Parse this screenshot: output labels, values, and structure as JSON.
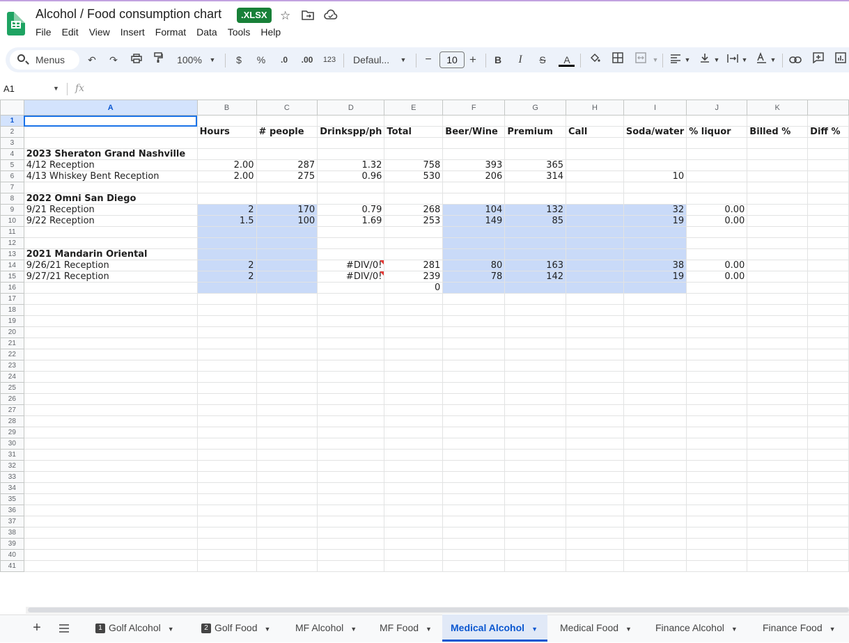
{
  "document": {
    "title": "Alcohol /  Food consumption chart",
    "badge": ".XLSX"
  },
  "menu": [
    "File",
    "Edit",
    "View",
    "Insert",
    "Format",
    "Data",
    "Tools",
    "Help"
  ],
  "toolbar": {
    "search_label": "Menus",
    "zoom": "100%",
    "currency": "$",
    "percent": "%",
    "decrease_decimals": ".0",
    "increase_decimals": ".00",
    "number_format": "123",
    "font": "Defaul...",
    "font_size": "10",
    "minus": "−",
    "plus": "+",
    "bold": "B",
    "italic": "I",
    "strike": "S",
    "text_color": "A"
  },
  "formula_bar": {
    "cell_ref": "A1",
    "fx": "fx"
  },
  "sheet": {
    "columns": [
      "A",
      "B",
      "C",
      "D",
      "E",
      "F",
      "G",
      "H",
      "I",
      "J",
      "K"
    ],
    "row_header_labels": [
      "1",
      "2",
      "3",
      "4",
      "5",
      "6",
      "7",
      "8",
      "9",
      "10",
      "11",
      "12",
      "13",
      "14",
      "15",
      "16",
      "17",
      "18",
      "19",
      "20",
      "21",
      "22",
      "23",
      "24",
      "25",
      "26",
      "27",
      "28",
      "29",
      "30",
      "31",
      "32",
      "33",
      "34",
      "35",
      "36",
      "37",
      "38",
      "39",
      "40",
      "41"
    ],
    "headers": [
      "",
      "Hours",
      "# people",
      "Drinkspp/ph",
      "Total",
      "Beer/Wine",
      "Premium",
      "Call",
      "Soda/water",
      "% liquor",
      "Billed %",
      "Diff %"
    ],
    "rows": {
      "r4": {
        "A": "2023 Sheraton Grand Nashville"
      },
      "r5": {
        "A": "4/12 Reception",
        "B": "2.00",
        "C": "287",
        "D": "1.32",
        "E": "758",
        "F": "393",
        "G": "365"
      },
      "r6": {
        "A": "4/13 Whiskey Bent Reception",
        "B": "2.00",
        "C": "275",
        "D": "0.96",
        "E": "530",
        "F": "206",
        "G": "314",
        "I": "10"
      },
      "r8": {
        "A": "2022 Omni San Diego"
      },
      "r9": {
        "A": "9/21 Reception",
        "B": "2",
        "C": "170",
        "D": "0.79",
        "E": "268",
        "F": "104",
        "G": "132",
        "I": "32",
        "J": "0.00"
      },
      "r10": {
        "A": "9/22 Reception",
        "B": "1.5",
        "C": "100",
        "D": "1.69",
        "E": "253",
        "F": "149",
        "G": "85",
        "I": "19",
        "J": "0.00"
      },
      "r13": {
        "A": "2021 Mandarin Oriental"
      },
      "r14": {
        "A": "9/26/21 Reception",
        "B": "2",
        "D": "#DIV/0!",
        "E": "281",
        "F": "80",
        "G": "163",
        "I": "38",
        "J": "0.00"
      },
      "r15": {
        "A": "9/27/21 Reception",
        "B": "2",
        "D": "#DIV/0!",
        "E": "239",
        "F": "78",
        "G": "142",
        "I": "19",
        "J": "0.00"
      },
      "r16": {
        "E": "0"
      }
    }
  },
  "tabs": [
    {
      "label": "Golf Alcohol",
      "num": "1"
    },
    {
      "label": "Golf Food",
      "num": "2"
    },
    {
      "label": "MF Alcohol"
    },
    {
      "label": "MF Food"
    },
    {
      "label": "Medical Alcohol",
      "active": true
    },
    {
      "label": "Medical Food"
    },
    {
      "label": "Finance Alcohol"
    },
    {
      "label": "Finance Food"
    }
  ],
  "colors": {
    "accent": "#0b57d0",
    "badge": "#188038",
    "shade": "#c9daf8",
    "logo": "#1ea362"
  }
}
